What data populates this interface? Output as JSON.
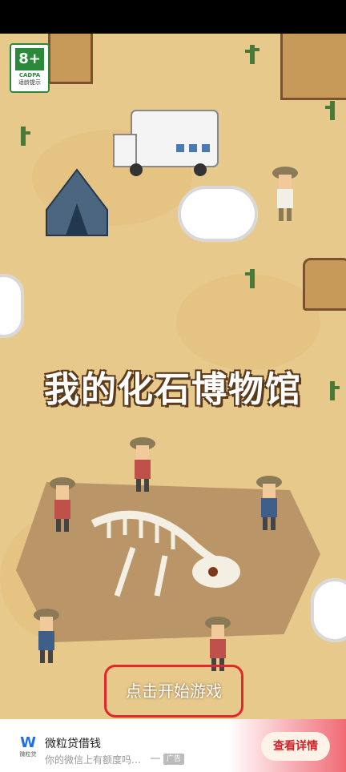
{
  "rating": {
    "age": "8+",
    "org": "CADPA",
    "tip": "适龄提示"
  },
  "game": {
    "title": "我的化石博物馆",
    "start": "点击开始游戏"
  },
  "ad": {
    "logo_caption": "微粒贷",
    "title": "微粒贷借钱",
    "subtitle": "你的微信上有额度吗…",
    "tag": "广告",
    "button": "查看详情"
  },
  "colors": {
    "highlight": "#e3262a",
    "accent": "#f06a76"
  }
}
